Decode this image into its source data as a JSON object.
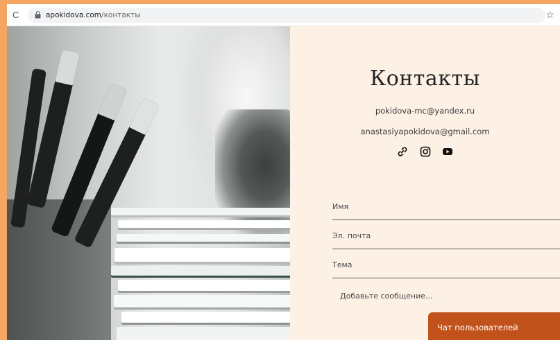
{
  "browser": {
    "url_domain": "apokidova.com",
    "url_path": "/контакты",
    "reload_icon": "reload-icon",
    "lock_icon": "lock-icon",
    "bookmark_icon": "star-icon"
  },
  "contacts": {
    "title": "Контакты",
    "email_1": "pokidova-mc@yandex.ru",
    "email_2": "anastasiyapokidova@gmail.com",
    "social_icons": [
      "link-icon",
      "instagram-icon",
      "youtube-icon"
    ]
  },
  "form": {
    "name_label": "Имя",
    "email_label": "Эл. почта",
    "subject_label": "Тема",
    "message_placeholder": "Добавьте сообщение..."
  },
  "chat": {
    "label": "Чат пользователей",
    "color": "#c2521c"
  },
  "colors": {
    "frame": "#f4a55e",
    "panel_bg": "#fdf1e6"
  }
}
